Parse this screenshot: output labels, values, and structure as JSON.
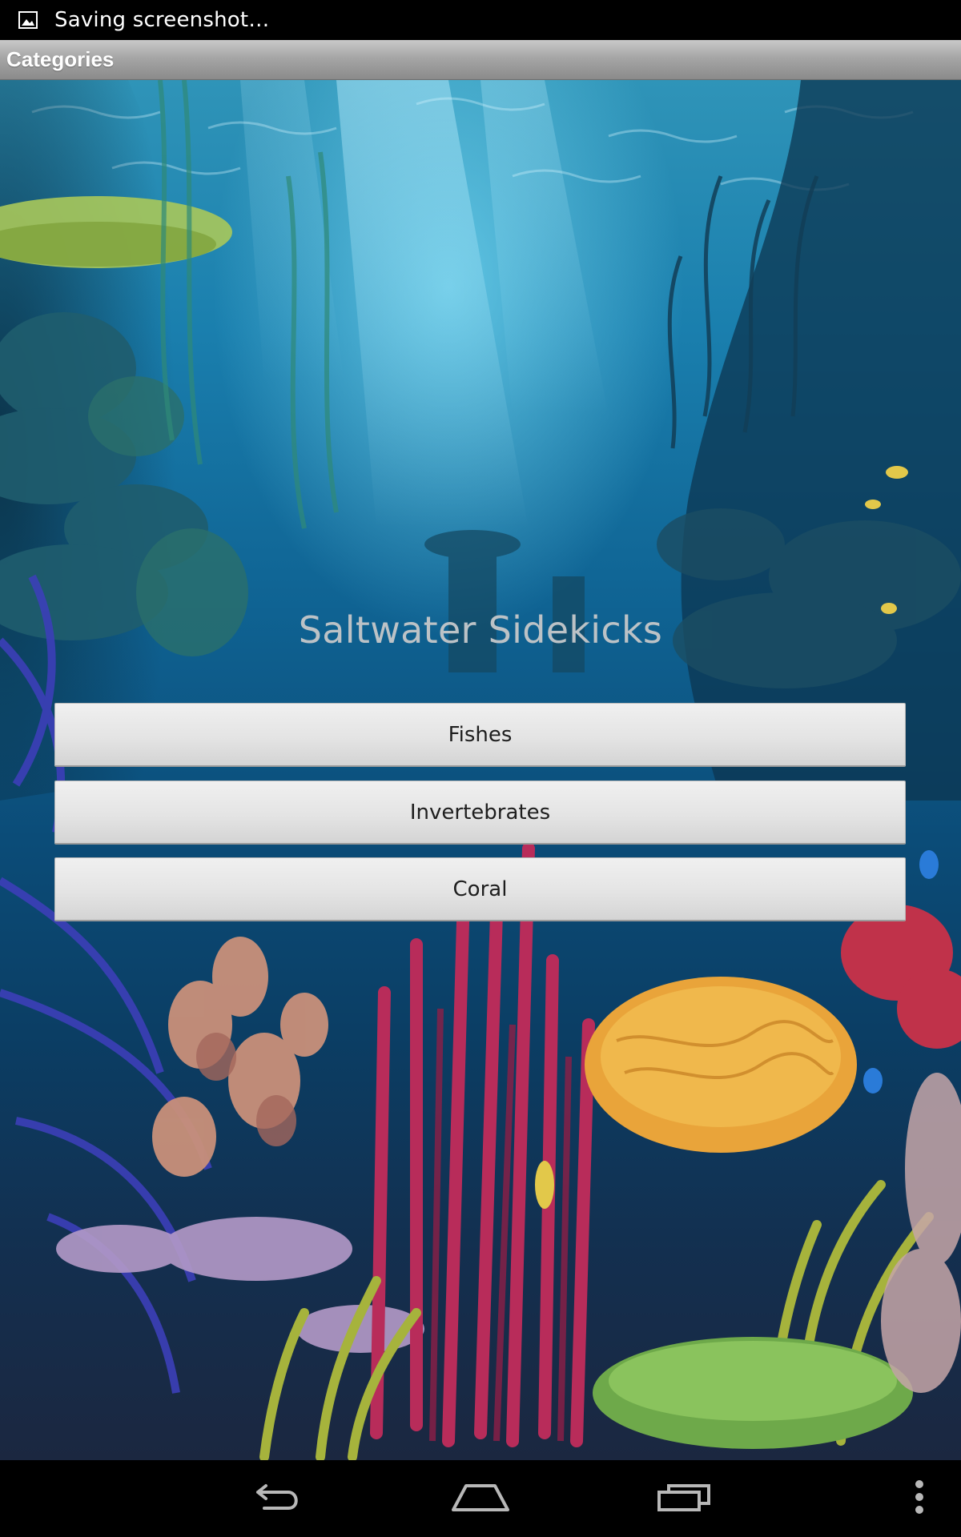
{
  "status_bar": {
    "notification_icon": "image-icon",
    "text": "Saving screenshot…"
  },
  "action_bar": {
    "title": "Categories"
  },
  "main": {
    "app_title": "Saltwater Sidekicks",
    "buttons": [
      {
        "label": "Fishes"
      },
      {
        "label": "Invertebrates"
      },
      {
        "label": "Coral"
      }
    ]
  },
  "nav_bar": {
    "icons": [
      "back-icon",
      "home-icon",
      "recent-apps-icon",
      "overflow-menu-icon"
    ]
  },
  "colors": {
    "status_bar": "#000000",
    "action_bar": "#a6a6a6",
    "water": "#0f6393",
    "button": "#e4e4e4",
    "title_text": "#bcc2c6"
  }
}
